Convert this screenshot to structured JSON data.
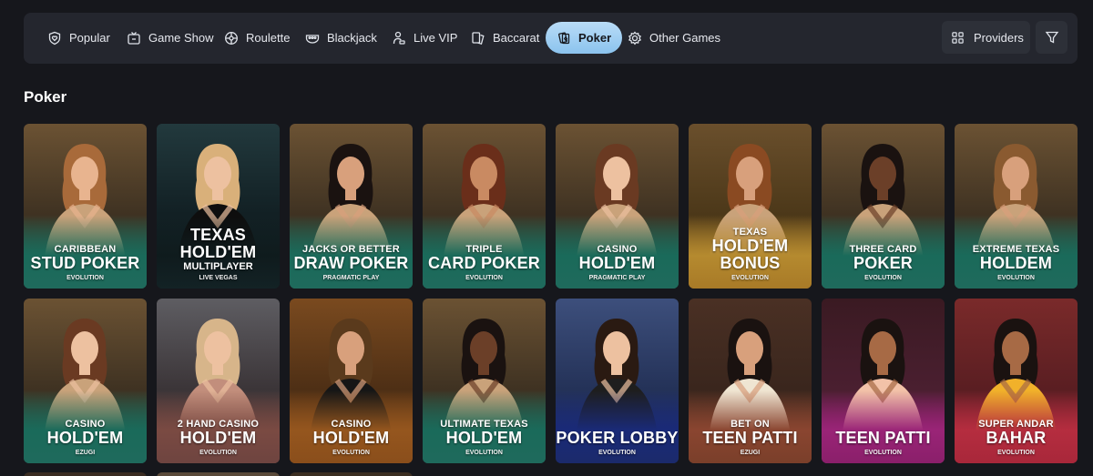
{
  "nav": {
    "tabs": [
      {
        "label": "Popular",
        "icon": "shield-heart-icon",
        "active": false
      },
      {
        "label": "Game Show",
        "icon": "tv-icon",
        "active": false
      },
      {
        "label": "Roulette",
        "icon": "roulette-wheel-icon",
        "active": false
      },
      {
        "label": "Blackjack",
        "icon": "blackjack-table-icon",
        "active": false
      },
      {
        "label": "Live VIP",
        "icon": "dealer-icon",
        "active": false
      },
      {
        "label": "Baccarat",
        "icon": "cards-icon",
        "active": false
      },
      {
        "label": "Poker",
        "icon": "poker-cards-icon",
        "active": true
      },
      {
        "label": "Other Games",
        "icon": "gear-chip-icon",
        "active": false
      }
    ],
    "providers_label": "Providers",
    "providers_icon": "grid-icon",
    "filter_icon": "funnel-icon"
  },
  "section": {
    "title": "Poker"
  },
  "colors": {
    "accent": "#8bc3ee",
    "background": "#16171c",
    "bar": "#24262e"
  },
  "games": [
    {
      "line1": "Caribbean",
      "line2": "Stud Poker",
      "line3": "",
      "provider": "Evolution",
      "theme": "teal"
    },
    {
      "line1": "",
      "line2": "Texas Hold'em",
      "line3": "Multiplayer",
      "provider": "Live Vegas",
      "theme": "dark"
    },
    {
      "line1": "Jacks or Better",
      "line2": "Draw Poker",
      "line3": "",
      "provider": "Pragmatic Play",
      "theme": "teal"
    },
    {
      "line1": "Triple",
      "line2": "Card Poker",
      "line3": "",
      "provider": "Evolution",
      "theme": "teal"
    },
    {
      "line1": "Casino",
      "line2": "Hold'em",
      "line3": "",
      "provider": "Pragmatic Play",
      "theme": "teal"
    },
    {
      "line1": "Texas",
      "line2": "Hold'em Bonus",
      "line3": "",
      "provider": "Evolution",
      "theme": "gold"
    },
    {
      "line1": "Three Card",
      "line2": "Poker",
      "line3": "",
      "provider": "Evolution",
      "theme": "teal"
    },
    {
      "line1": "Extreme Texas",
      "line2": "Holdem",
      "line3": "",
      "provider": "Evolution",
      "theme": "teal"
    },
    {
      "line1": "Casino",
      "line2": "Hold'em",
      "line3": "",
      "provider": "Ezugi",
      "theme": "teal"
    },
    {
      "line1": "2 Hand Casino",
      "line2": "Hold'em",
      "line3": "",
      "provider": "Evolution",
      "theme": "rose"
    },
    {
      "line1": "Casino",
      "line2": "Hold'em",
      "line3": "",
      "provider": "Evolution",
      "theme": "orange"
    },
    {
      "line1": "Ultimate Texas",
      "line2": "Hold'em",
      "line3": "",
      "provider": "Evolution",
      "theme": "teal"
    },
    {
      "line1": "",
      "line2": "Poker Lobby",
      "line3": "",
      "provider": "Evolution",
      "theme": "navy"
    },
    {
      "line1": "Bet On",
      "line2": "Teen Patti",
      "line3": "",
      "provider": "Ezugi",
      "theme": "brown"
    },
    {
      "line1": "",
      "line2": "Teen Patti",
      "line3": "",
      "provider": "Evolution",
      "theme": "magenta"
    },
    {
      "line1": "Super Andar",
      "line2": "Bahar",
      "line3": "",
      "provider": "Evolution",
      "theme": "crimson"
    }
  ]
}
